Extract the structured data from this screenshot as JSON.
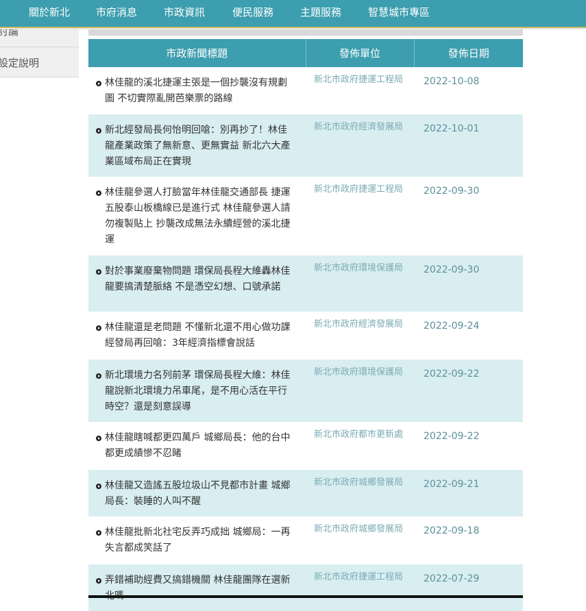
{
  "nav": {
    "items": [
      "關於新北",
      "市府消息",
      "市政資訊",
      "便民服務",
      "主題服務",
      "智慧城市專區"
    ]
  },
  "sidebar": {
    "items": [
      "討論",
      "設定說明"
    ]
  },
  "table": {
    "headers": {
      "title": "市政新聞標題",
      "unit": "發佈單位",
      "date": "發佈日期"
    },
    "rows": [
      {
        "title": "林佳龍的溪北捷運主張是一個抄襲沒有規劃圖 不切實際亂開芭樂票的路線",
        "unit": "新北市政府捷運工程局",
        "date": "2022-10-08"
      },
      {
        "title": "新北經發局長何怡明回嗆：別再抄了！林佳龍產業政策了無新意、更無實益 新北六大產業區域布局正在實現",
        "unit": "新北市政府經濟發展局",
        "date": "2022-10-01"
      },
      {
        "title": "林佳龍參選人打臉當年林佳龍交通部長 捷運五股泰山板橋線已是進行式 林佳龍參選人請勿複製貼上 抄襲改成無法永續經營的溪北捷運",
        "unit": "新北市政府捷運工程局",
        "date": "2022-09-30"
      },
      {
        "title": "對於事業廢棄物問題 環保局長程大維轟林佳龍要搞清楚脈絡 不是憑空幻想、口號承諾",
        "unit": "新北市政府環境保護局",
        "date": "2022-09-30"
      },
      {
        "title": "林佳龍還是老問題 不懂新北還不用心做功課 經發局再回嗆：3年經濟指標會說話",
        "unit": "新北市政府經濟發展局",
        "date": "2022-09-24"
      },
      {
        "title": "新北環境力名列前茅 環保局長程大維：林佳龍說新北環境力吊車尾，是不用心活在平行時空？還是刻意誤導",
        "unit": "新北市政府環境保護局",
        "date": "2022-09-22"
      },
      {
        "title": "林佳龍瞎喊都更四萬戶 城鄉局長：他的台中都更成績慘不忍睹",
        "unit": "新北市政府都市更新處",
        "date": "2022-09-22"
      },
      {
        "title": "林佳龍又造謠五股垃圾山不見都市計畫 城鄉局長：裝睡的人叫不醒",
        "unit": "新北市政府城鄉發展局",
        "date": "2022-09-21"
      },
      {
        "title": "林佳龍批新北社宅反弄巧成拙 城鄉局：一再失言都成笑話了",
        "unit": "新北市政府城鄉發展局",
        "date": "2022-09-18"
      },
      {
        "title": "弄錯補助經費又搞錯機關 林佳龍團隊在選新北嗎",
        "unit": "新北市政府捷運工程局",
        "date": "2022-07-29"
      }
    ]
  },
  "colors": {
    "nav_bg": "#3c9eae",
    "row_alt_bg": "#d9eef1",
    "unit_text": "#7aaab3",
    "date_text": "#5b8f99"
  }
}
